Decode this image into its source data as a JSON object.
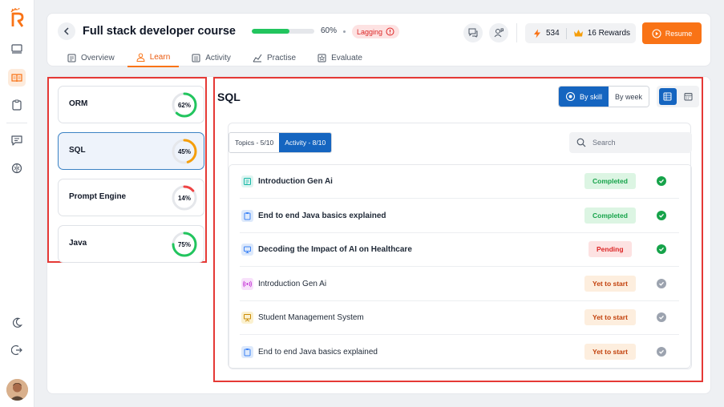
{
  "header": {
    "course_title": "Full stack developer course",
    "progress_value": 0.6,
    "progress_label": "60%",
    "status_badge": "Lagging",
    "points": "534",
    "rewards": "16 Rewards",
    "resume_label": "Resume"
  },
  "tabs": [
    {
      "label": "Overview",
      "icon": "document-icon"
    },
    {
      "label": "Learn",
      "icon": "learner-icon"
    },
    {
      "label": "Activity",
      "icon": "list-icon"
    },
    {
      "label": "Practise",
      "icon": "chart-icon"
    },
    {
      "label": "Evaluate",
      "icon": "star-badge-icon"
    }
  ],
  "topics": [
    {
      "name": "ORM",
      "percent": 62,
      "percent_label": "62%",
      "color": "#22c55e"
    },
    {
      "name": "SQL",
      "percent": 45,
      "percent_label": "45%",
      "color": "#f59e0b"
    },
    {
      "name": "Prompt Engine",
      "percent": 14,
      "percent_label": "14%",
      "color": "#ef4444"
    },
    {
      "name": "Java",
      "percent": 75,
      "percent_label": "75%",
      "color": "#22c55e"
    }
  ],
  "detail": {
    "title": "SQL",
    "view_by": {
      "skill": "By skill",
      "week": "By week"
    },
    "panel_tabs": {
      "topics": "Topics - 5/10",
      "activity": "Activity - 8/10"
    },
    "search_placeholder": "Search"
  },
  "activities": [
    {
      "title": "Introduction Gen Ai",
      "status": "Completed",
      "status_kind": "completed",
      "icon": "document-icon",
      "icon_color": "#14b8a6",
      "icon_bg": "#dff5f1",
      "bold": true,
      "done": true
    },
    {
      "title": "End to end Java basics explained",
      "status": "Completed",
      "status_kind": "completed",
      "icon": "clipboard-icon",
      "icon_color": "#3b82f6",
      "icon_bg": "#dde9fb",
      "bold": true,
      "done": true
    },
    {
      "title": "Decoding the Impact of AI on Healthcare",
      "status": "Pending",
      "status_kind": "pending",
      "icon": "monitor-icon",
      "icon_color": "#3b82f6",
      "icon_bg": "#dde9fb",
      "bold": true,
      "done": true
    },
    {
      "title": "Introduction Gen Ai",
      "status": "Yet to start",
      "status_kind": "yet",
      "icon": "broadcast-icon",
      "icon_color": "#c026d3",
      "icon_bg": "#f8e1fb",
      "bold": false,
      "done": false
    },
    {
      "title": "Student Management System",
      "status": "Yet to start",
      "status_kind": "yet",
      "icon": "presentation-icon",
      "icon_color": "#ca8a04",
      "icon_bg": "#fbf1cf",
      "bold": false,
      "done": false
    },
    {
      "title": "End to end Java basics explained",
      "status": "Yet to start",
      "status_kind": "yet",
      "icon": "clipboard-icon",
      "icon_color": "#3b82f6",
      "icon_bg": "#dde9fb",
      "bold": false,
      "done": false
    }
  ],
  "colors": {
    "accent": "#f97316",
    "primary": "#1565c0",
    "success": "#16a34a",
    "danger": "#dc2626"
  }
}
